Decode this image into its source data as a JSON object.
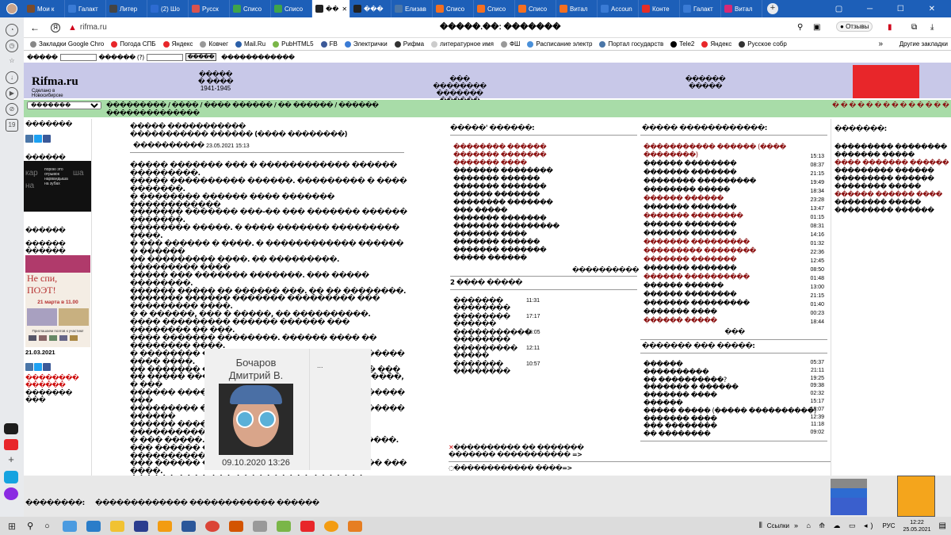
{
  "browser": {
    "tabs": [
      "Мои к",
      "Галакт",
      "Литер",
      "(2) Шо",
      "Русск",
      "Списо",
      "Списо",
      "��",
      "���",
      "Елизав",
      "Списо",
      "Списо",
      "Списо",
      "Витал",
      "Accoun",
      "Конте",
      "Галакт",
      "Витал"
    ],
    "tab_colors": [
      "#7a4b2a",
      "#3a7bd5",
      "#444",
      "#2d6bd1",
      "#d9534f",
      "#3fa44a",
      "#3fa44a",
      "#222",
      "#222",
      "#4a76a8",
      "#f36f21",
      "#f36f21",
      "#f36f21",
      "#f36f21",
      "#3a7bd5",
      "#e52d27",
      "#3a7bd5",
      "#d62976"
    ],
    "url": "rifma.ru",
    "page_title": "�����.��: �������",
    "reviews_label": "Отзывы",
    "bookmarks": [
      "Закладки Google Chro",
      "Погода СПБ",
      "Яндекс",
      "Ковчег",
      "Mail.Ru",
      "PubHTML5",
      "FB",
      "Электрички",
      "Рифма",
      "литературное имя",
      "ФШ",
      "Расписание электр",
      "Портал государств",
      "Tele2",
      "Яндекс",
      "Русское собр"
    ],
    "other_bookmarks": "Другие закладки"
  },
  "topform": {
    "label1": "�����",
    "label2": "������ (?)",
    "button": "�����",
    "label3": "������������"
  },
  "header": {
    "logo": "Rifma.ru",
    "logo_sub": "Сделано в Новосибирске",
    "col1_title": "�����",
    "col1_sub": "� ����",
    "col1_years": "1941-1945",
    "col2_line1": "��� ��������",
    "col2_line2": "������� ������",
    "col3_line1": "������",
    "col3_line2": "�����"
  },
  "greenbar": {
    "select": "�������",
    "links": "��������� / ���� / ���� ������ / �� ������ / ������",
    "links2": "��������������",
    "right": "� � � � � � � � � � � � � �"
  },
  "left": {
    "title1": "�������",
    "title2": "������",
    "ad_text1": "порою это",
    "ad_text2": "отрывок",
    "ad_text3": "нарвандыша",
    "ad_text4": "на зубах",
    "ad_bg1": "кар",
    "ad_bg2": "ша",
    "ad_bg3": "на",
    "title3": "������",
    "title4": "������",
    "title5": "������",
    "poster_title1": "Не спи,",
    "poster_title2": "ПОЭТ!",
    "poster_date": "21 марта в 11.00",
    "poster_invite": "Приглашаем поэтов к участию!",
    "date": "21.03.2021",
    "red_link1": "��������",
    "red_link2": "������",
    "link3": "������� ���"
  },
  "article": {
    "title1": "����� �����������",
    "title2": "����������� ������ (���� ��������)",
    "author": "����������",
    "date": "23.05.2021 15:13",
    "paragraphs": [
      "����� ������� ��� � ������������ ������ ���������.",
      "����� ���������� ������. ��������� � ���� �������.",
      "� �������� ������ ���� ������� ������������",
      "������� ������� ���-�� ��� ������� ������ �������.",
      "�������� �����. � ���� ������� ��������� ����.",
      "� ��� ������ � ����. � ������������ ������ � ������",
      "�� ��������� ����. �� ���������. ��������� ����",
      "����� ��� ������� �������. ��� ����� ��������.",
      "������ ����� �� ������ ���. �� �� ��������.",
      "������� ������ ������� ��������� ��� ��������� ����.",
      "� � ������, ��� � �����, �� ����������.",
      "���� ��������� ������ ������ ��� �������� �� ���.",
      "���� ������� ��������. ������ ���� �� �������� ����.",
      "� �������� ���������� ��� ������� ������ ���� ����.",
      "�� ������� ������ ��� ��� �� � �����. � ���",
      "�� ����� ������ ����� ������. �� ��������, � ���",
      "������ ������� �����. �������� ��������� ���",
      "��������� ��������� � �������� � ������� ������",
      "������ ����� ������ � �� ������ ���������� �������",
      "� ��� �����. �������. ������� ���� ������.",
      "��� ������ ���� �. ������� ������ ������������.",
      "��� ������ ��� ��� ������� ���������� ��� ����.",
      "������ ���� ��� ���������� ������� ������ �������.",
      "� ������ ����� ���. ������ ����������� �� ����."
    ],
    "photo_caption1": "Бочаров",
    "photo_caption2": "Дмитрий В.",
    "photo_date": "09.10.2020 13:26",
    "photo_more": "..."
  },
  "mid": {
    "title": "�����' ������:",
    "items": [
      "�������� ������",
      "������� �������",
      "������� ����",
      "������� ��������",
      "������� ������",
      "������� �������",
      "������ �������",
      "�������� �������",
      "��� �����",
      "������� �������",
      "������� ���������",
      "������� ����",
      "������� ������",
      "������� �������",
      "����� ������"
    ],
    "more": "����������",
    "title2": "2 ���� �����",
    "items2": [
      {
        "t": "�������",
        "t2": "��������",
        "time": "11:31"
      },
      {
        "t": "��������",
        "t2": "������",
        "time": "17:17"
      },
      {
        "t": "�����������",
        "t2": "��������",
        "time": "15:05"
      },
      {
        "t": "���������",
        "t2": "�����",
        "time": "12:11"
      },
      {
        "t": "�������",
        "t2": "��������",
        "time": "10:57"
      }
    ],
    "bottom1": "���������� �� �������",
    "bottom2": "������� ����������� =>",
    "bottom3": "������������ ����=>"
  },
  "recent": {
    "title": "����� ������������:",
    "items": [
      {
        "t": "����������� ������ (���� ��������)",
        "time": "15:13",
        "red": true
      },
      {
        "t": "������ ��������",
        "time": "08:37",
        "red": false
      },
      {
        "t": "������� �������",
        "time": "21:15",
        "red": false
      },
      {
        "t": "�������� ���������",
        "time": "19:49",
        "red": false
      },
      {
        "t": "�������� �����",
        "time": "18:34",
        "red": false
      },
      {
        "t": "������ ������",
        "time": "23:28",
        "red": true
      },
      {
        "t": "������� �������",
        "time": "13:47",
        "red": false
      },
      {
        "t": "������� ��������",
        "time": "01:15",
        "red": true
      },
      {
        "t": "������ ��������",
        "time": "08:31",
        "red": false
      },
      {
        "t": "������� �������",
        "time": "14:16",
        "red": false
      },
      {
        "t": "������� ���������",
        "time": "01:32",
        "red": true
      },
      {
        "t": "��������� ��������",
        "time": "22:36",
        "red": true
      },
      {
        "t": "������� �������",
        "time": "12:45",
        "red": true
      },
      {
        "t": "������� �������",
        "time": "08:50",
        "red": false
      },
      {
        "t": "������ ����������",
        "time": "01:48",
        "red": true
      },
      {
        "t": "������ ������",
        "time": "13:00",
        "red": false
      },
      {
        "t": "������ ��������",
        "time": "21:15",
        "red": false
      },
      {
        "t": "������� ���������",
        "time": "01:40",
        "red": false
      },
      {
        "t": "������� ����",
        "time": "00:23",
        "red": false
      },
      {
        "t": "������ �����",
        "time": "18:44",
        "red": true
      }
    ],
    "more": "���",
    "title2": "������� ��� �����:",
    "items2": [
      {
        "t": "������",
        "time": "05:37"
      },
      {
        "t": "����������",
        "time": "21:11"
      },
      {
        "t": "�� ����������?",
        "time": "19:25"
      },
      {
        "t": "������� � ������",
        "time": "09:38"
      },
      {
        "t": "������� ����",
        "time": "02:32"
      },
      {
        "t": "������",
        "time": "15:17"
      },
      {
        "t": "����� ����� (����� ����������)",
        "time": "18:07"
      },
      {
        "t": "������� ����",
        "time": "12:39"
      },
      {
        "t": "��� ��������",
        "time": "11:18"
      },
      {
        "t": "�� ��������",
        "time": "09:02"
      }
    ]
  },
  "right": {
    "title": "�������:",
    "items": [
      "��������� ��������",
      "������� �����",
      "���� ������� ������",
      "��������� ������",
      "��������� ������",
      "�������� �����",
      "������ ������ ����",
      "�������� �����",
      "��������� ������"
    ]
  },
  "footer": {
    "label": "��������:",
    "text": "������������� ������������ ������"
  },
  "taskbar": {
    "links": "Ссылки",
    "lang": "РУС",
    "time": "12:22",
    "date": "25.05.2021"
  }
}
